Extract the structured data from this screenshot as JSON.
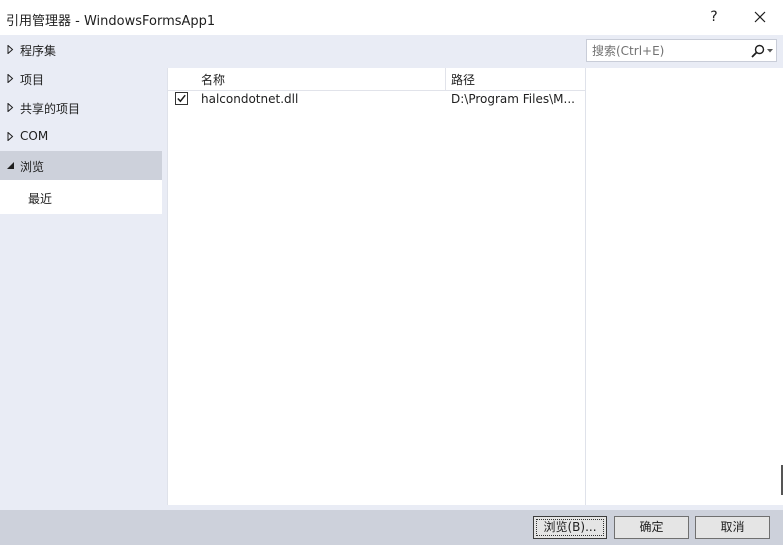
{
  "window": {
    "title": "引用管理器 - WindowsFormsApp1",
    "help_label": "?"
  },
  "nav": {
    "items": [
      {
        "label": "程序集",
        "state": "collapsed"
      },
      {
        "label": "项目",
        "state": "collapsed"
      },
      {
        "label": "共享的项目",
        "state": "collapsed"
      },
      {
        "label": "COM",
        "state": "collapsed"
      },
      {
        "label": "浏览",
        "state": "expanded"
      },
      {
        "label": "最近",
        "state": "selected-child"
      }
    ]
  },
  "search": {
    "placeholder": "搜索(Ctrl+E)"
  },
  "list": {
    "columns": [
      "名称",
      "路径"
    ],
    "rows": [
      {
        "checked": true,
        "name": "halcondotnet.dll",
        "path": "D:\\Program Files\\M..."
      }
    ]
  },
  "footer": {
    "browse_label": "浏览(B)...",
    "ok_label": "确定",
    "cancel_label": "取消"
  },
  "colors": {
    "nav_bg": "#e9ecf5",
    "expanded_bg": "#cdd1db",
    "footer_bg": "#cdd1db"
  }
}
